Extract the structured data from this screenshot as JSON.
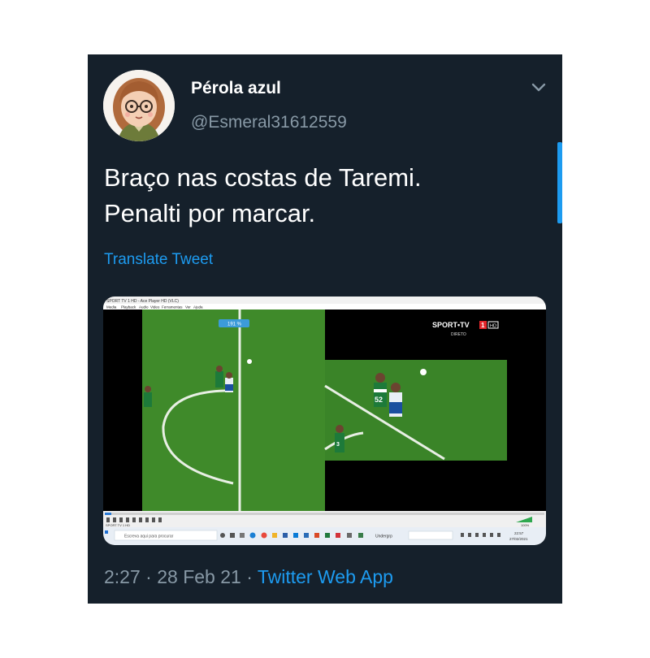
{
  "tweet": {
    "display_name": "Pérola azul",
    "handle": "@Esmeral31612559",
    "text_lines": [
      "Braço nas costas de Taremi.",
      "Penalti por marcar."
    ],
    "translate_label": "Translate Tweet",
    "time": "2:27",
    "separator": "·",
    "date": "28 Feb 21",
    "via_app": "Twitter Web App"
  },
  "media": {
    "player_title": "SPORT TV 1 HD - Ace Player HD (VLC)",
    "menu_items": [
      "Media",
      "Playback",
      "Audio",
      "Video",
      "Ferramentas",
      "Ver",
      "Ajuda"
    ],
    "zoom_badge": "191 %",
    "broadcaster": "SPORT•TV",
    "broadcaster_number": "1",
    "broadcaster_hd": "HD",
    "broadcast_status": "DIRETO",
    "jersey_number": "52",
    "jersey_number_small": "3",
    "taskbar_search_placeholder": "Escreva aqui para procurar",
    "taskbar_time": "22:57",
    "taskbar_date": "27/02/2021",
    "playlist_label": "SPORT TV 1 HD",
    "now_playing_label": "Undergrp",
    "volume_value": "100%"
  },
  "colors": {
    "card_bg": "#15202b",
    "text_primary": "#ffffff",
    "text_secondary": "#8899a6",
    "link": "#1d9bf0",
    "pitch": "#3f8a2a"
  }
}
